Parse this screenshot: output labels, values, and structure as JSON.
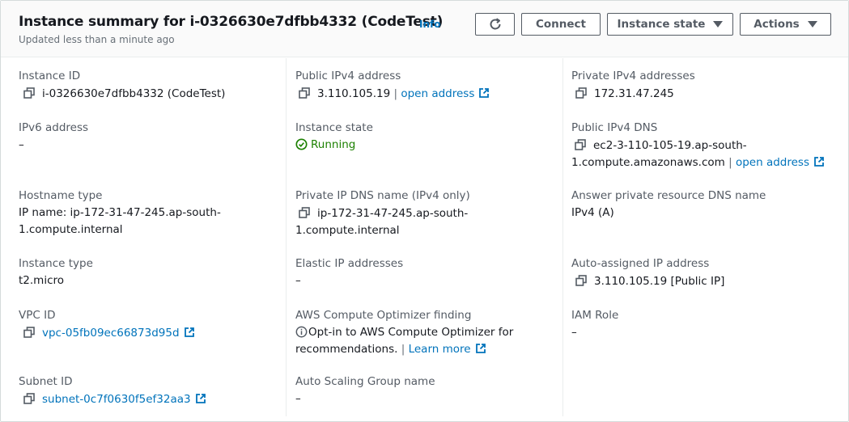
{
  "header": {
    "title": "Instance summary for i-0326630e7dfbb4332 (CodeTest)",
    "info": "Info",
    "updated": "Updated less than a minute ago",
    "connect_label": "Connect",
    "instance_state_label": "Instance state",
    "actions_label": "Actions"
  },
  "fields": {
    "instance_id": {
      "label": "Instance ID",
      "value": "i-0326630e7dfbb4332 (CodeTest)"
    },
    "public_ipv4": {
      "label": "Public IPv4 address",
      "value": "3.110.105.19",
      "sep": "|",
      "link": "open address"
    },
    "private_ipv4": {
      "label": "Private IPv4 addresses",
      "value": "172.31.47.245"
    },
    "ipv6": {
      "label": "IPv6 address",
      "value": "–"
    },
    "instance_state": {
      "label": "Instance state",
      "value": "Running"
    },
    "public_dns": {
      "label": "Public IPv4 DNS",
      "value_line1": "ec2-3-110-105-19.ap-south-",
      "value_line2": "1.compute.amazonaws.com",
      "sep": "|",
      "link": "open address"
    },
    "hostname_type": {
      "label": "Hostname type",
      "value_line1": "IP name: ip-172-31-47-245.ap-south-",
      "value_line2": "1.compute.internal"
    },
    "private_dns": {
      "label": "Private IP DNS name (IPv4 only)",
      "value_line1": "ip-172-31-47-245.ap-south-",
      "value_line2": "1.compute.internal"
    },
    "answer_dns": {
      "label": "Answer private resource DNS name",
      "value": "IPv4 (A)"
    },
    "instance_type": {
      "label": "Instance type",
      "value": "t2.micro"
    },
    "elastic_ip": {
      "label": "Elastic IP addresses",
      "value": "–"
    },
    "auto_ip": {
      "label": "Auto-assigned IP address",
      "value": "3.110.105.19 [Public IP]"
    },
    "vpc_id": {
      "label": "VPC ID",
      "value": "vpc-05fb09ec66873d95d"
    },
    "optimizer": {
      "label": "AWS Compute Optimizer finding",
      "value_line1": "Opt-in to AWS Compute Optimizer for",
      "value_line2": "recommendations.",
      "sep": "|",
      "link": "Learn more"
    },
    "iam_role": {
      "label": "IAM Role",
      "value": "–"
    },
    "subnet_id": {
      "label": "Subnet ID",
      "value": "subnet-0c7f0630f5ef32aa3"
    },
    "asg_name": {
      "label": "Auto Scaling Group name",
      "value": "–"
    }
  },
  "colors": {
    "link": "#0073bb",
    "success": "#1d8102",
    "label": "#545b64",
    "text": "#16191f"
  }
}
